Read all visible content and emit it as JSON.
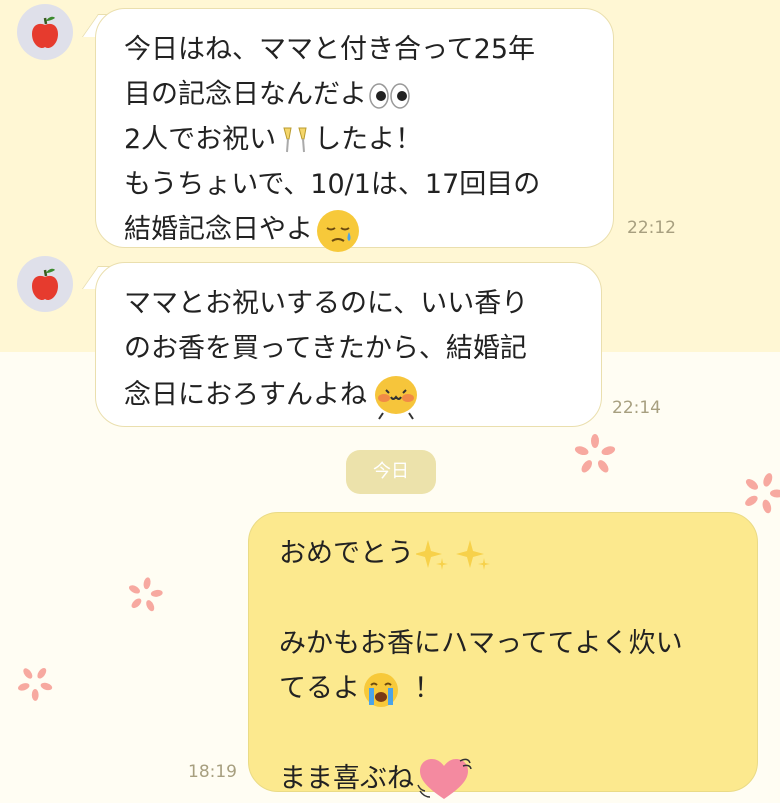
{
  "colors": {
    "incoming_bubble": "#ffffff",
    "outgoing_bubble": "#fce98e",
    "top_background": "#fff7d4",
    "chat_background": "#fffdf3",
    "timestamp": "#a79f7f",
    "flower_decoration": "#f7a9a0"
  },
  "messages": [
    {
      "direction": "incoming",
      "avatar": "apple-icon",
      "lines": [
        "今日はね、ママと付き合って25年",
        "目の記念日なんだよ",
        "2人でお祝い",
        "したよ！",
        "もうちょいで、10/1は、17回目の",
        "結婚記念日やよ"
      ],
      "emojis": [
        "eyes-emoji",
        "champagne-toast-emoji",
        "tear-face-emoji"
      ],
      "time": "22:12"
    },
    {
      "direction": "incoming",
      "avatar": "apple-icon",
      "lines": [
        "ママとお祝いするのに、いい香り",
        "のお香を買ってきたから、結婚記",
        "念日におろすんよね"
      ],
      "emojis": [
        "chick-blush-emoji"
      ],
      "time": "22:14"
    },
    {
      "direction": "outgoing",
      "lines": [
        "おめでとう",
        "",
        "みかもお香にハマっててよく炊い",
        "てるよ",
        "！",
        "",
        "まま喜ぶね"
      ],
      "emojis": [
        "sparkles-emoji",
        "crying-face-emoji",
        "pink-heart-emoji"
      ],
      "time": "18:19"
    }
  ],
  "date_separator": "今日"
}
